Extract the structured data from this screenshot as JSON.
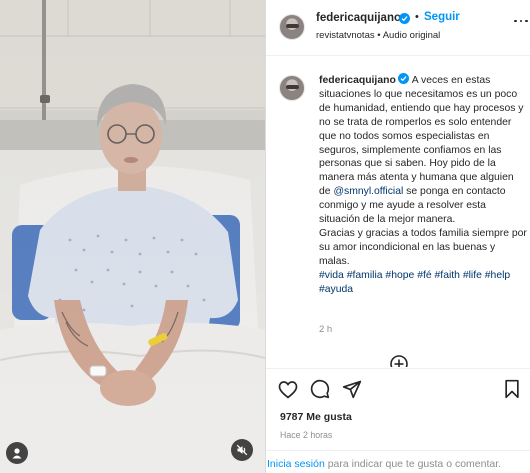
{
  "post": {
    "username": "federicaquijano",
    "follow_label": "Seguir",
    "dot": "•",
    "audio_account": "revistatvnotas",
    "audio_label": "Audio original",
    "caption_username": "federicaquijano",
    "caption_part1": "A veces en estas situaciones lo que necesitamos es un poco de humanidad, entiendo que hay procesos y no se trata de romperlos es solo entender que no todos somos especialistas en seguros, simplemente confiamos en las personas que si saben. Hoy pido de la manera más atenta y humana que alguien de ",
    "caption_mention": "@smnyl.official",
    "caption_part2": " se ponga en contacto conmigo y me ayude a resolver esta situación de la mejor manera.",
    "caption_thanks": "Gracias y gracias a todos familia siempre por su amor incondicional en las buenas y malas.",
    "hashtags": "#vida #familia #hope #fé #faith #life #help #ayuda",
    "caption_time": "2 h",
    "likes": "9787 Me gusta",
    "posted_ago": "Hace 2 horas"
  },
  "footer": {
    "login_link": "Inicia sesión",
    "login_rest": " para indicar que te gusta o comentar."
  },
  "icons": {
    "verified": "verified-badge-icon",
    "like": "heart-icon",
    "comment": "comment-bubble-icon",
    "share": "paper-plane-icon",
    "save": "bookmark-icon",
    "more": "more-options-icon",
    "load_more": "plus-circle-icon",
    "user_tag": "user-tag-icon",
    "mute": "muted-speaker-icon"
  },
  "colors": {
    "accent": "#0095f6",
    "link": "#00376b",
    "text": "#262626",
    "muted": "#8e8e8e"
  }
}
